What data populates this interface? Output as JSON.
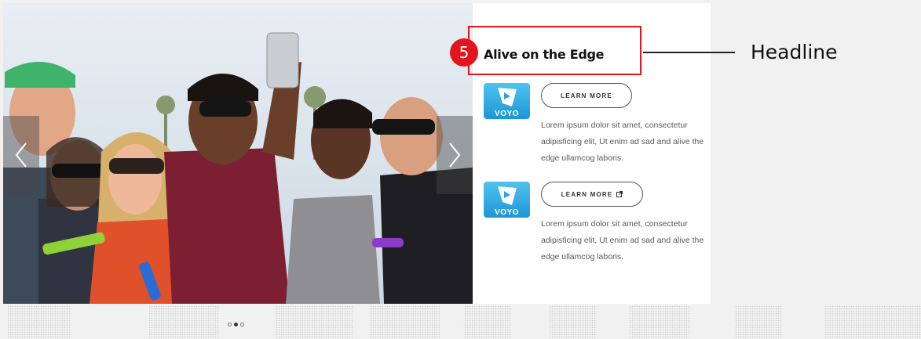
{
  "slider": {
    "prev_icon": "chevron-left-icon",
    "next_icon": "chevron-right-icon",
    "dots": [
      false,
      true,
      false
    ]
  },
  "annotation": {
    "badge_number": "5",
    "label": "Headline",
    "color": "#e2141d"
  },
  "content": {
    "headline": "Alive on the Edge",
    "items": [
      {
        "logo_text": "VOYO",
        "button_label": "LEARN MORE",
        "button_icon": "",
        "description": "Lorem ipsum dolor sit amet, consectetur adipisficing elit, Ut enim ad sad and alive the edge ullamcog laboris."
      },
      {
        "logo_text": "VOYO",
        "button_label": "LEARN MORE",
        "button_icon": "external-link-icon",
        "description": "Lorem ipsum dolor sit amet, consectetur adipisficing elit, Ut enim ad sad and alive the edge ullamcog laboris."
      }
    ]
  },
  "colors": {
    "logo_blue": "#2aa3e0",
    "page_bg": "#f1f1f1"
  }
}
